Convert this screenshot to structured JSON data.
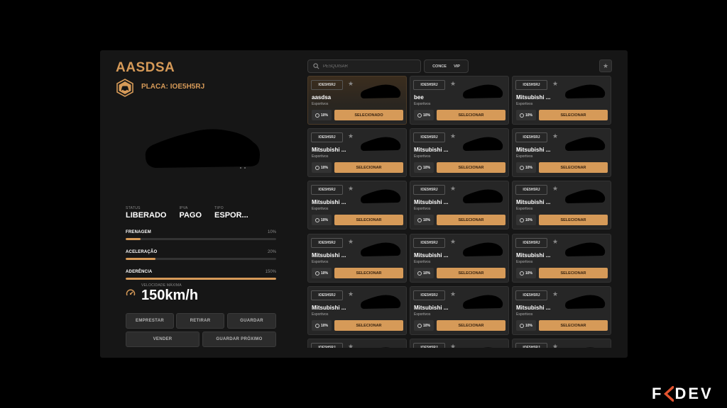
{
  "vehicle": {
    "title": "AASDSA",
    "plate_label": "PLACA:",
    "plate": "IOE5H5RJ",
    "stats": [
      {
        "label": "STATUS",
        "value": "LIBERADO"
      },
      {
        "label": "IPVA",
        "value": "PAGO"
      },
      {
        "label": "TIPO",
        "value": "ESPOR..."
      }
    ],
    "bars": [
      {
        "name": "FRENAGEM",
        "pct": "10%",
        "level": 10
      },
      {
        "name": "ACELERAÇÃO",
        "pct": "20%",
        "level": 20
      },
      {
        "name": "ADERÊNCIA",
        "pct": "150%",
        "level": 100
      }
    ],
    "speed_label": "VELOCIDADE MÁXIMA",
    "speed": "150km/h"
  },
  "actions": {
    "emprestar": "EMPRESTAR",
    "retirar": "RETIRAR",
    "guardar": "GUARDAR",
    "vender": "VENDER",
    "guardar_proximo": "GUARDAR PRÓXIMO"
  },
  "search": {
    "placeholder": "PESQUISAR"
  },
  "filters": {
    "conce": "CONCE",
    "vip": "VIP"
  },
  "icons": {
    "favorite": "star-icon",
    "search": "search-icon",
    "plate": "car-hexagon-icon",
    "speed": "speedometer-icon"
  },
  "colors": {
    "accent": "#d69a58",
    "panel": "#161616",
    "card": "#262626"
  },
  "cars": [
    {
      "tag": "IOE5H5RJ",
      "name": "aasdsa",
      "category": "Esportivos",
      "badge": "10%",
      "button": "SELECIONADO",
      "active": true
    },
    {
      "tag": "IOE5H5RJ",
      "name": "bee",
      "category": "Esportivos",
      "badge": "10%",
      "button": "SELECIONAR"
    },
    {
      "tag": "IOE5H5RJ",
      "name": "Mitsubishi ...",
      "category": "Esportivos",
      "badge": "10%",
      "button": "SELECIONAR"
    },
    {
      "tag": "IOE5H5RJ",
      "name": "Mitsubishi ...",
      "category": "Esportivos",
      "badge": "10%",
      "button": "SELECIONAR"
    },
    {
      "tag": "IOE5H5RJ",
      "name": "Mitsubishi ...",
      "category": "Esportivos",
      "badge": "10%",
      "button": "SELECIONAR"
    },
    {
      "tag": "IOE5H5RJ",
      "name": "Mitsubishi ...",
      "category": "Esportivos",
      "badge": "10%",
      "button": "SELECIONAR"
    },
    {
      "tag": "IOE5H5RJ",
      "name": "Mitsubishi ...",
      "category": "Esportivos",
      "badge": "10%",
      "button": "SELECIONAR"
    },
    {
      "tag": "IOE5H5RJ",
      "name": "Mitsubishi ...",
      "category": "Esportivos",
      "badge": "10%",
      "button": "SELECIONAR"
    },
    {
      "tag": "IOE5H5RJ",
      "name": "Mitsubishi ...",
      "category": "Esportivos",
      "badge": "10%",
      "button": "SELECIONAR"
    },
    {
      "tag": "IOE5H5RJ",
      "name": "Mitsubishi ...",
      "category": "Esportivos",
      "badge": "10%",
      "button": "SELECIONAR"
    },
    {
      "tag": "IOE5H5RJ",
      "name": "Mitsubishi ...",
      "category": "Esportivos",
      "badge": "10%",
      "button": "SELECIONAR"
    },
    {
      "tag": "IOE5H5RJ",
      "name": "Mitsubishi ...",
      "category": "Esportivos",
      "badge": "10%",
      "button": "SELECIONAR"
    },
    {
      "tag": "IOE5H5RJ",
      "name": "Mitsubishi ...",
      "category": "Esportivos",
      "badge": "10%",
      "button": "SELECIONAR"
    },
    {
      "tag": "IOE5H5RJ",
      "name": "Mitsubishi ...",
      "category": "Esportivos",
      "badge": "10%",
      "button": "SELECIONAR"
    },
    {
      "tag": "IOE5H5RJ",
      "name": "Mitsubishi ...",
      "category": "Esportivos",
      "badge": "10%",
      "button": "SELECIONAR"
    },
    {
      "tag": "IOE5H5RJ",
      "name": "",
      "category": "",
      "badge": "",
      "button": ""
    },
    {
      "tag": "IOE5H5RJ",
      "name": "",
      "category": "",
      "badge": "",
      "button": ""
    },
    {
      "tag": "IOE5H5RJ",
      "name": "",
      "category": "",
      "badge": "",
      "button": ""
    }
  ],
  "brand": {
    "logo_left": "F",
    "logo_right": "DEV"
  }
}
